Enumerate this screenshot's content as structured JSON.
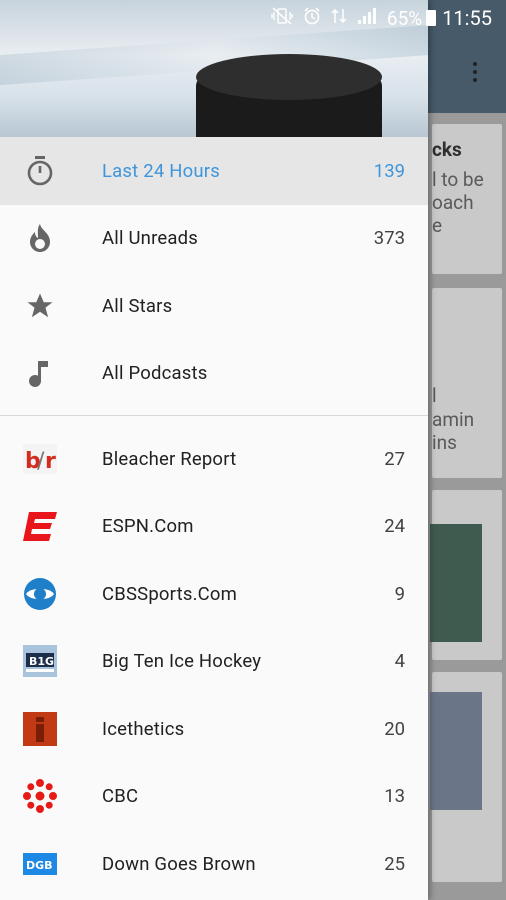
{
  "status_bar": {
    "battery": "65%",
    "time": "11:55"
  },
  "background_app": {
    "card_text_lines": [
      "cks",
      "l to be",
      "oach",
      "e",
      "l",
      "amin",
      "ins"
    ]
  },
  "drawer": {
    "smart_feeds": [
      {
        "label": "Last 24 Hours",
        "count": "139",
        "icon": "stopwatch-icon",
        "active": true
      },
      {
        "label": "All Unreads",
        "count": "373",
        "icon": "flame-icon"
      },
      {
        "label": "All Stars",
        "count": "",
        "icon": "star-icon"
      },
      {
        "label": "All Podcasts",
        "count": "",
        "icon": "music-note-icon"
      }
    ],
    "feeds": [
      {
        "label": "Bleacher Report",
        "count": "27",
        "icon": "bleacher-report-logo"
      },
      {
        "label": "ESPN.Com",
        "count": "24",
        "icon": "espn-logo"
      },
      {
        "label": "CBSSports.Com",
        "count": "9",
        "icon": "cbs-eye-logo"
      },
      {
        "label": "Big Ten Ice Hockey",
        "count": "4",
        "icon": "big-ten-logo"
      },
      {
        "label": "Icethetics",
        "count": "20",
        "icon": "icethetics-logo"
      },
      {
        "label": "CBC",
        "count": "13",
        "icon": "cbc-logo"
      },
      {
        "label": "Down Goes Brown",
        "count": "25",
        "icon": "dgb-logo"
      }
    ]
  },
  "colors": {
    "accent": "#3f95dc",
    "active_row": "#e6e6e6"
  }
}
